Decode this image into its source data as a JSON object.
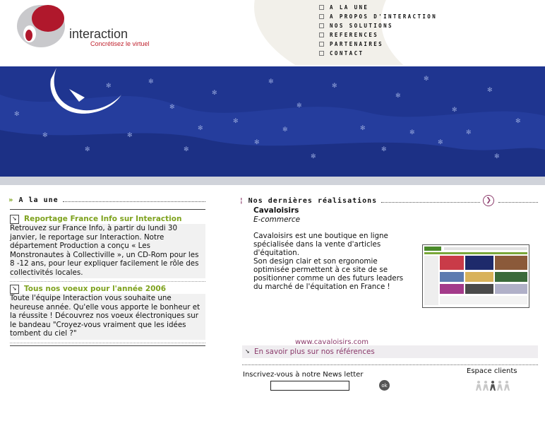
{
  "brand": {
    "name": "interaction",
    "tagline": "Concrétisez le virtuel"
  },
  "nav": [
    {
      "label": "A LA UNE"
    },
    {
      "label": "A PROPOS D'INTERACTION"
    },
    {
      "label": "NOS SOLUTIONS"
    },
    {
      "label": "REFERENCES"
    },
    {
      "label": "PARTENAIRES"
    },
    {
      "label": "CONTACT"
    }
  ],
  "colors": {
    "banner": "#1f3590",
    "news_title": "#7ea21e",
    "accent": "#8b3a6b",
    "logo_red": "#b0182c"
  },
  "left": {
    "title": "A la une",
    "news": [
      {
        "title": "Reportage France Info sur Interaction",
        "body": "Retrouvez sur France Info, à partir du lundi 30 janvier, le reportage sur Interaction. Notre département Production a conçu « Les Monstronautes à Collectiville », un CD-Rom pour les 8 -12 ans, pour leur expliquer facilement le rôle des collectivités locales."
      },
      {
        "title": "Tous nos voeux pour l'année 2006",
        "body": "Toute l'équipe Interaction vous souhaite une heureuse année. Qu'elle vous apporte le bonheur et la réussite ! Découvrez nos voeux électroniques sur le bandeau \"Croyez-vous vraiment que les idées tombent du ciel ?\""
      }
    ]
  },
  "right": {
    "title": "Nos dernières réalisations",
    "project": {
      "name": "Cavaloisirs",
      "type": "E-commerce",
      "description": "Cavaloisirs est une boutique en ligne spécialisée dans la vente d'articles d'équitation.\nSon design clair et son ergonomie optimisée permettent à ce site de se positionner comme un des futurs leaders du marché de l'équitation en France !",
      "link": "www.cavaloisirs.com"
    },
    "more": "En savoir plus sur nos références",
    "newsletter": {
      "label": "Inscrivez-vous à notre News letter",
      "value": "",
      "ok": "ok"
    },
    "clients": {
      "label": "Espace clients"
    }
  }
}
